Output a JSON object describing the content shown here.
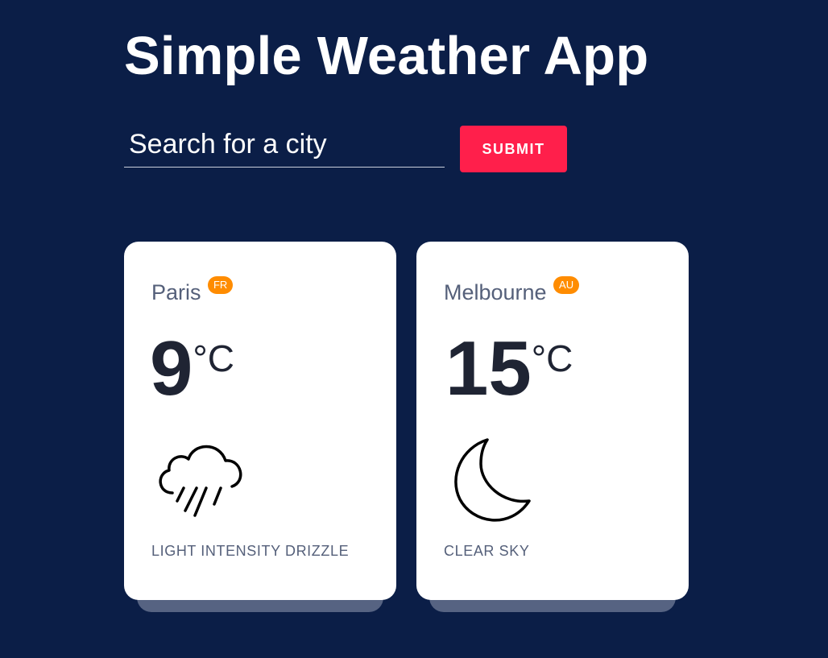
{
  "app": {
    "title": "Simple Weather App"
  },
  "search": {
    "placeholder": "Search for a city",
    "value": "",
    "submit_label": "SUBMIT"
  },
  "colors": {
    "background": "#0b1e47",
    "accent": "#ff1f4b",
    "badge": "#ff8c00",
    "card": "#ffffff"
  },
  "cards": [
    {
      "city": "Paris",
      "country": "FR",
      "temp": "9",
      "unit": "°C",
      "icon": "rain-cloud-icon",
      "description": "LIGHT INTENSITY DRIZZLE"
    },
    {
      "city": "Melbourne",
      "country": "AU",
      "temp": "15",
      "unit": "°C",
      "icon": "crescent-moon-icon",
      "description": "CLEAR SKY"
    }
  ]
}
